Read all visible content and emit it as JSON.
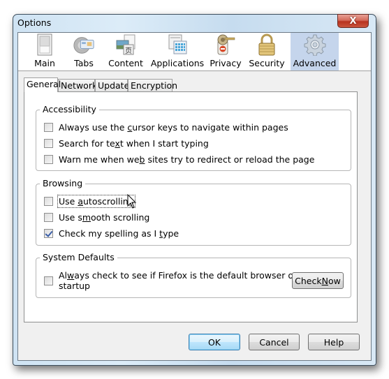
{
  "window": {
    "title": "Options",
    "close_label": "X"
  },
  "toolbar": {
    "items": [
      {
        "label": "Main",
        "icon": "switch-icon"
      },
      {
        "label": "Tabs",
        "icon": "tabs-gear-icon"
      },
      {
        "label": "Content",
        "icon": "content-pictures-icon"
      },
      {
        "label": "Applications",
        "icon": "applications-icon"
      },
      {
        "label": "Privacy",
        "icon": "privacy-key-icon"
      },
      {
        "label": "Security",
        "icon": "padlock-icon"
      },
      {
        "label": "Advanced",
        "icon": "gear-icon"
      }
    ],
    "selected": "Advanced"
  },
  "tabs": {
    "items": [
      "General",
      "Network",
      "Update",
      "Encryption"
    ],
    "active": "General"
  },
  "accessibility": {
    "title": "Accessibility",
    "options": [
      {
        "pre": "Always use the ",
        "u": "c",
        "post": "ursor keys to navigate within pages",
        "checked": false
      },
      {
        "pre": "Search for te",
        "u": "x",
        "post": "t when I start typing",
        "checked": false
      },
      {
        "pre": "Warn me when we",
        "u": "b",
        "post": " sites try to redirect or reload the page",
        "checked": false
      }
    ]
  },
  "browsing": {
    "title": "Browsing",
    "options": [
      {
        "pre": "Use ",
        "u": "a",
        "post": "utoscrolling",
        "checked": false,
        "focused": true
      },
      {
        "pre": "Use s",
        "u": "m",
        "post": "ooth scrolling",
        "checked": false
      },
      {
        "pre": "Check my spelling as I ",
        "u": "t",
        "post": "ype",
        "checked": true
      }
    ]
  },
  "system_defaults": {
    "title": "System Defaults",
    "option": {
      "pre": "Al",
      "u": "w",
      "post": "ays check to see if Firefox is the default browser on",
      "line2": "startup",
      "checked": false
    },
    "check_now": {
      "pre": "Check ",
      "u": "N",
      "post": "ow"
    }
  },
  "buttons": {
    "ok": "OK",
    "cancel": "Cancel",
    "help": "Help"
  },
  "colors": {
    "selected_toolbar_bg": "#c5d5ec",
    "close_button": "#c9543d",
    "default_button_border": "#3c7fb1"
  }
}
